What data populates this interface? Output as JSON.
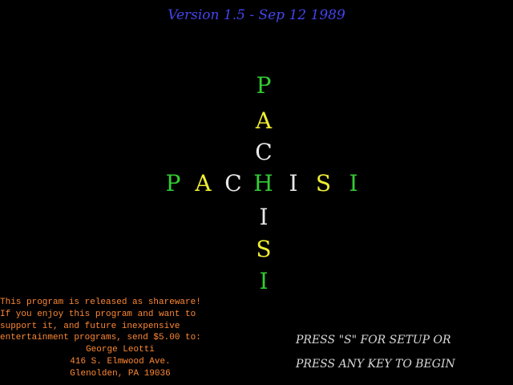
{
  "version_text": "Version 1.5 - Sep 12 1989",
  "colors": {
    "background": "#000000",
    "version": "#4444ee",
    "green": "#33cc33",
    "yellow": "#eeee33",
    "white": "#e8e8e8",
    "shareware": "#ff8833",
    "prompt": "#d8d8d8"
  },
  "title": {
    "horizontal": [
      {
        "ch": "P",
        "color": "#33cc33"
      },
      {
        "ch": "A",
        "color": "#eeee33"
      },
      {
        "ch": "C",
        "color": "#e8e8e8"
      },
      {
        "ch": "H",
        "color": "#33cc33"
      },
      {
        "ch": "I",
        "color": "#e8e8e8"
      },
      {
        "ch": "S",
        "color": "#eeee33"
      },
      {
        "ch": "I",
        "color": "#33cc33"
      }
    ],
    "vertical": [
      {
        "ch": "P",
        "color": "#33cc33"
      },
      {
        "ch": "A",
        "color": "#eeee33"
      },
      {
        "ch": "C",
        "color": "#e8e8e8"
      },
      {
        "ch": "H",
        "color": "#33cc33"
      },
      {
        "ch": "I",
        "color": "#e8e8e8"
      },
      {
        "ch": "S",
        "color": "#eeee33"
      },
      {
        "ch": "I",
        "color": "#33cc33"
      }
    ]
  },
  "shareware": {
    "lines": [
      "This program is released as shareware!",
      "If you enjoy this program and want to",
      "support it, and future inexpensive",
      "entertainment programs, send $5.00 to:"
    ],
    "address": [
      "George Leotti",
      "416 S. Elmwood Ave.",
      "Glenolden, PA 19036"
    ]
  },
  "prompts": {
    "setup": "PRESS \"S\" FOR SETUP OR",
    "begin": "PRESS ANY KEY TO BEGIN"
  }
}
